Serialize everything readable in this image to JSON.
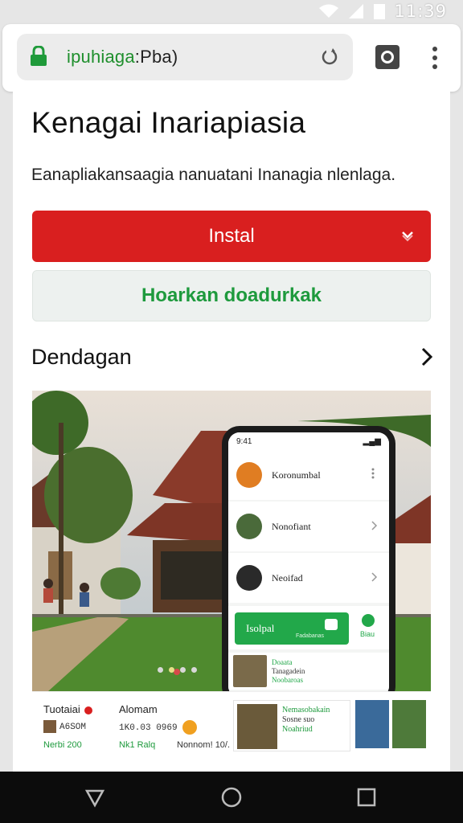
{
  "status_bar": {
    "time": "11:39",
    "icons": [
      "wifi-icon",
      "signal-icon",
      "battery-icon"
    ]
  },
  "browser": {
    "url_highlight": "ipuhiaga",
    "url_rest": ":Pba)",
    "icons": [
      "lock-icon",
      "reload-icon",
      "screenshot-icon",
      "overflow-menu-icon"
    ]
  },
  "page": {
    "title": "Kenagai Inariapiasia",
    "description": "Eanapliakansaagia nanuatani Inanagia nlenlaga.",
    "install_label": "Instal",
    "secondary_label": "Hoarkan doadurkak",
    "section_title": "Dendagan"
  },
  "phone": {
    "status_time": "9:41",
    "items": [
      {
        "label": "Koronumbal",
        "avatar_color": "#e07d22",
        "kind": "dots"
      },
      {
        "label": "Nonofiant",
        "avatar_color": "#4a6a3a",
        "kind": "chevron"
      },
      {
        "label": "Neoifad",
        "avatar_color": "#2a2a2a",
        "kind": "chevron"
      }
    ],
    "cta_label": "Isolpal",
    "cta_sub": "Fadabanas",
    "side_label": "Biau",
    "thumb_line1": "Doaata",
    "thumb_line2": "Tanagadein",
    "thumb_line3": "Noobaroas"
  },
  "info_strip": {
    "col1_title": "Tuotaiai",
    "col1_value": "A6SOM",
    "col2_title": "Alomam",
    "col2_value": "1K0.03 0969",
    "tag1": "Nerbi 200",
    "tag2": "Nk1 Ralq",
    "tag3": "Nonnom! 10/.",
    "card_line1": "Nemasobakain",
    "card_line2": "Sosne suo",
    "card_line3": "Noahriud"
  },
  "colors": {
    "accent_red": "#d91f1f",
    "accent_green": "#1e9a3d"
  }
}
